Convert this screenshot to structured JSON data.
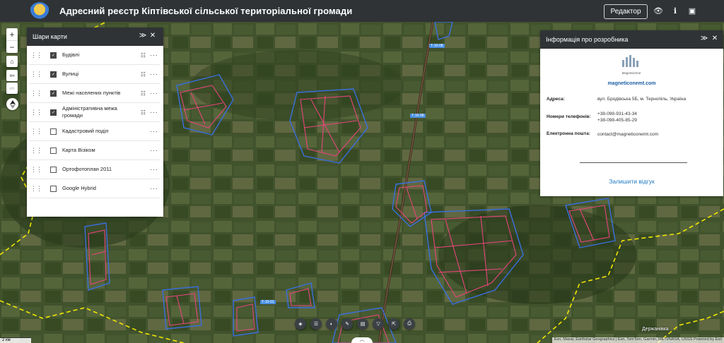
{
  "header": {
    "title": "Адресний реєстр Кіптівської сільської територіальної громади",
    "editor_label": "Редактор"
  },
  "layers_panel": {
    "title": "Шари карти",
    "items": [
      {
        "label": "Будівлі",
        "checked": true,
        "legend": true
      },
      {
        "label": "Вулиці",
        "checked": true,
        "legend": true
      },
      {
        "label": "Межі населених пунктів",
        "checked": true,
        "legend": true
      },
      {
        "label": "Адміністративна межа громади",
        "checked": true,
        "legend": true
      },
      {
        "label": "Кадастровий поділ",
        "checked": false,
        "legend": false
      },
      {
        "label": "Карта Візіком",
        "checked": false,
        "legend": false
      },
      {
        "label": "Ортофотоплан 2011",
        "checked": false,
        "legend": false
      },
      {
        "label": "Google Hybrid",
        "checked": false,
        "legend": false
      }
    ]
  },
  "developer_panel": {
    "title": "Інформація про розробника",
    "logo_text": "MagneticOne",
    "website": "magneticonemt.com",
    "address_label": "Адреса:",
    "address_value": "вул. Бродівська 5Б, м. Тернопіль, Україна",
    "phones_label": "Номери телефонів:",
    "phone_1": "+38-098-931-43-34",
    "phone_2": "+38-098-405-85-29",
    "email_label": "Електронна пошта:",
    "email_value": "contact@magneticonemt.com",
    "feedback_label": "Залишити відгук"
  },
  "map": {
    "scale_label": "2 км",
    "attribution": "Esri, Maxar, Earthstar Geographics | Esri, TomTom, Garmin, METI/NASA, USGS   Powered by Esri",
    "place_label": "Держанівка",
    "road_tags": [
      "Т-10-08",
      "Т-10-08",
      "Т-10-01"
    ]
  },
  "colors": {
    "header_bg": "#2f3336",
    "boundary": "#f2e600",
    "settlement": "#3a6fe0",
    "streets": "#e8457a",
    "link": "#1b5ea6"
  }
}
